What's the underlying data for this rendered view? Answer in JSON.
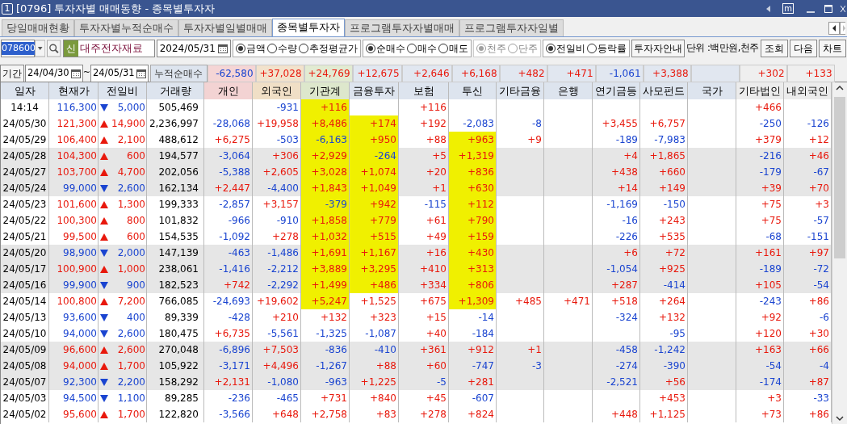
{
  "window": {
    "number": "1",
    "title": "[0796] 투자자별 매매동향 - 종목별투자자",
    "m_label": "m"
  },
  "tabs": [
    {
      "label": "당일매매현황",
      "selected": false
    },
    {
      "label": "투자자별누적순매수",
      "selected": false
    },
    {
      "label": "투자자별일별매매",
      "selected": false
    },
    {
      "label": "종목별투자자",
      "selected": true
    },
    {
      "label": "프로그램투자자별매매",
      "selected": false
    },
    {
      "label": "프로그램투자자일별",
      "selected": false
    }
  ],
  "toolbar": {
    "code": "078600",
    "badge": "신",
    "stock_name": "대주전자재료",
    "date": "2024/05/31",
    "radio_groups": [
      {
        "disabled": false,
        "options": [
          {
            "label": "금액",
            "selected": true
          },
          {
            "label": "수량",
            "selected": false
          },
          {
            "label": "추정평균가",
            "selected": false
          }
        ]
      },
      {
        "disabled": false,
        "options": [
          {
            "label": "순매수",
            "selected": true
          },
          {
            "label": "매수",
            "selected": false
          },
          {
            "label": "매도",
            "selected": false
          }
        ]
      },
      {
        "disabled": true,
        "options": [
          {
            "label": "천주",
            "selected": true
          },
          {
            "label": "단주",
            "selected": false
          }
        ]
      },
      {
        "disabled": false,
        "options": [
          {
            "label": "전일비",
            "selected": true
          },
          {
            "label": "등락률",
            "selected": false
          }
        ]
      }
    ],
    "guide_button": "투자자안내",
    "unit": "단위 :백만원,천주",
    "buttons": [
      "조회",
      "다음",
      "차트"
    ]
  },
  "period": {
    "label": "기간",
    "from": "24/04/30",
    "sep": "~",
    "to": "24/05/31",
    "summary_label": "누적순매수",
    "summary": {
      "individual": "-62,580",
      "foreign": "+37,028",
      "institution": "+24,769",
      "financial": "+12,675",
      "insurance": "+2,646",
      "trust": "+6,168",
      "other_finance": "+482",
      "bank": "+471",
      "pension": "-1,061",
      "private_fund": "+3,388",
      "other_corp": "+302",
      "domestic_foreign": "+133"
    }
  },
  "columns": [
    "일자",
    "현재가",
    "전일비",
    "거래량",
    "개인",
    "외국인",
    "기관계",
    "금융투자",
    "보험",
    "투신",
    "기타금융",
    "은행",
    "연기금등",
    "사모펀드",
    "국가",
    "기타법인",
    "내외국인"
  ],
  "rows": [
    {
      "date": "14:14",
      "price": "116,300",
      "change": "5,000",
      "volume": "505,469",
      "rising": false,
      "shaded": false,
      "highlighted": {
        "institution": true,
        "financial": false,
        "trust": false
      },
      "investors": {
        "foreign": "-931",
        "institution": "+116",
        "insurance": "+116",
        "other_corp": "+466"
      }
    },
    {
      "date": "24/05/30",
      "price": "121,300",
      "change": "14,900",
      "volume": "2,236,997",
      "rising": true,
      "shaded": false,
      "highlighted": {
        "institution": true,
        "financial": true,
        "trust": false
      },
      "investors": {
        "individual": "-28,068",
        "foreign": "+19,958",
        "institution": "+8,486",
        "financial": "+174",
        "insurance": "+192",
        "trust": "-2,083",
        "other_finance": "-8",
        "pension": "+3,455",
        "private_fund": "+6,757",
        "other_corp": "-250",
        "domestic_foreign": "-126"
      }
    },
    {
      "date": "24/05/29",
      "price": "106,400",
      "change": "2,100",
      "volume": "488,612",
      "rising": true,
      "shaded": false,
      "highlighted": {
        "institution": true,
        "financial": true,
        "trust": true
      },
      "investors": {
        "individual": "+6,275",
        "foreign": "-503",
        "institution": "-6,163",
        "financial": "+950",
        "insurance": "+88",
        "trust": "+963",
        "other_finance": "+9",
        "pension": "-189",
        "private_fund": "-7,983",
        "other_corp": "+379",
        "domestic_foreign": "+12"
      }
    },
    {
      "date": "24/05/28",
      "price": "104,300",
      "change": "600",
      "volume": "194,577",
      "rising": true,
      "shaded": true,
      "highlighted": {
        "institution": true,
        "financial": true,
        "trust": true
      },
      "investors": {
        "individual": "-3,064",
        "foreign": "+306",
        "institution": "+2,929",
        "financial": "-264",
        "insurance": "+5",
        "trust": "+1,319",
        "pension": "+4",
        "private_fund": "+1,865",
        "other_corp": "-216",
        "domestic_foreign": "+46"
      }
    },
    {
      "date": "24/05/27",
      "price": "103,700",
      "change": "4,700",
      "volume": "202,056",
      "rising": true,
      "shaded": true,
      "highlighted": {
        "institution": true,
        "financial": true,
        "trust": true
      },
      "investors": {
        "individual": "-5,388",
        "foreign": "+2,605",
        "institution": "+3,028",
        "financial": "+1,074",
        "insurance": "+20",
        "trust": "+836",
        "pension": "+438",
        "private_fund": "+660",
        "other_corp": "-179",
        "domestic_foreign": "-67"
      }
    },
    {
      "date": "24/05/24",
      "price": "99,000",
      "change": "2,600",
      "volume": "162,134",
      "rising": false,
      "shaded": true,
      "highlighted": {
        "institution": true,
        "financial": true,
        "trust": true
      },
      "investors": {
        "individual": "+2,447",
        "foreign": "-4,400",
        "institution": "+1,843",
        "financial": "+1,049",
        "insurance": "+1",
        "trust": "+630",
        "pension": "+14",
        "private_fund": "+149",
        "other_corp": "+39",
        "domestic_foreign": "+70"
      }
    },
    {
      "date": "24/05/23",
      "price": "101,600",
      "change": "1,300",
      "volume": "199,333",
      "rising": true,
      "shaded": false,
      "highlighted": {
        "institution": true,
        "financial": true,
        "trust": true
      },
      "investors": {
        "individual": "-2,857",
        "foreign": "+3,157",
        "institution": "-379",
        "financial": "+942",
        "insurance": "-115",
        "trust": "+112",
        "pension": "-1,169",
        "private_fund": "-150",
        "other_corp": "+75",
        "domestic_foreign": "+3"
      }
    },
    {
      "date": "24/05/22",
      "price": "100,300",
      "change": "800",
      "volume": "101,832",
      "rising": true,
      "shaded": false,
      "highlighted": {
        "institution": true,
        "financial": true,
        "trust": true
      },
      "investors": {
        "individual": "-966",
        "foreign": "-910",
        "institution": "+1,858",
        "financial": "+779",
        "insurance": "+61",
        "trust": "+790",
        "pension": "-16",
        "private_fund": "+243",
        "other_corp": "+75",
        "domestic_foreign": "-57"
      }
    },
    {
      "date": "24/05/21",
      "price": "99,500",
      "change": "600",
      "volume": "154,535",
      "rising": true,
      "shaded": false,
      "highlighted": {
        "institution": true,
        "financial": true,
        "trust": true
      },
      "investors": {
        "individual": "-1,092",
        "foreign": "+278",
        "institution": "+1,032",
        "financial": "+515",
        "insurance": "+49",
        "trust": "+159",
        "pension": "-226",
        "private_fund": "+535",
        "other_corp": "-68",
        "domestic_foreign": "-151"
      }
    },
    {
      "date": "24/05/20",
      "price": "98,900",
      "change": "2,000",
      "volume": "147,139",
      "rising": false,
      "shaded": true,
      "highlighted": {
        "institution": true,
        "financial": true,
        "trust": true
      },
      "investors": {
        "individual": "-463",
        "foreign": "-1,486",
        "institution": "+1,691",
        "financial": "+1,167",
        "insurance": "+16",
        "trust": "+430",
        "pension": "+6",
        "private_fund": "+72",
        "other_corp": "+161",
        "domestic_foreign": "+97"
      }
    },
    {
      "date": "24/05/17",
      "price": "100,900",
      "change": "1,000",
      "volume": "238,061",
      "rising": true,
      "shaded": true,
      "highlighted": {
        "institution": true,
        "financial": true,
        "trust": true
      },
      "investors": {
        "individual": "-1,416",
        "foreign": "-2,212",
        "institution": "+3,889",
        "financial": "+3,295",
        "insurance": "+410",
        "trust": "+313",
        "pension": "-1,054",
        "private_fund": "+925",
        "other_corp": "-189",
        "domestic_foreign": "-72"
      }
    },
    {
      "date": "24/05/16",
      "price": "99,900",
      "change": "900",
      "volume": "182,523",
      "rising": false,
      "shaded": true,
      "highlighted": {
        "institution": true,
        "financial": true,
        "trust": true
      },
      "investors": {
        "individual": "+742",
        "foreign": "-2,292",
        "institution": "+1,499",
        "financial": "+486",
        "insurance": "+334",
        "trust": "+806",
        "pension": "+287",
        "private_fund": "-414",
        "other_corp": "+105",
        "domestic_foreign": "-54"
      }
    },
    {
      "date": "24/05/14",
      "price": "100,800",
      "change": "7,200",
      "volume": "766,085",
      "rising": true,
      "shaded": false,
      "highlighted": {
        "institution": true,
        "financial": false,
        "trust": true
      },
      "investors": {
        "individual": "-24,693",
        "foreign": "+19,602",
        "institution": "+5,247",
        "financial": "+1,525",
        "insurance": "+675",
        "trust": "+1,309",
        "other_finance": "+485",
        "bank": "+471",
        "pension": "+518",
        "private_fund": "+264",
        "other_corp": "-243",
        "domestic_foreign": "+86"
      }
    },
    {
      "date": "24/05/13",
      "price": "93,600",
      "change": "400",
      "volume": "89,339",
      "rising": false,
      "shaded": false,
      "investors": {
        "individual": "-428",
        "foreign": "+210",
        "institution": "+132",
        "financial": "+323",
        "insurance": "+15",
        "trust": "-14",
        "pension": "-324",
        "private_fund": "+132",
        "other_corp": "+92",
        "domestic_foreign": "-6"
      }
    },
    {
      "date": "24/05/10",
      "price": "94,000",
      "change": "2,600",
      "volume": "180,475",
      "rising": false,
      "shaded": false,
      "investors": {
        "individual": "+6,735",
        "foreign": "-5,561",
        "institution": "-1,325",
        "financial": "-1,087",
        "insurance": "+40",
        "trust": "-184",
        "private_fund": "-95",
        "other_corp": "+120",
        "domestic_foreign": "+30"
      }
    },
    {
      "date": "24/05/09",
      "price": "96,600",
      "change": "2,600",
      "volume": "270,048",
      "rising": true,
      "shaded": true,
      "investors": {
        "individual": "-6,896",
        "foreign": "+7,503",
        "institution": "-836",
        "financial": "-410",
        "insurance": "+361",
        "trust": "+912",
        "other_finance": "+1",
        "pension": "-458",
        "private_fund": "-1,242",
        "other_corp": "+163",
        "domestic_foreign": "+66"
      }
    },
    {
      "date": "24/05/08",
      "price": "94,000",
      "change": "1,700",
      "volume": "105,922",
      "rising": true,
      "shaded": true,
      "investors": {
        "individual": "-3,171",
        "foreign": "+4,496",
        "institution": "-1,267",
        "financial": "+88",
        "insurance": "+60",
        "trust": "-747",
        "other_finance": "-3",
        "pension": "-274",
        "private_fund": "-390",
        "other_corp": "-54",
        "domestic_foreign": "-4"
      }
    },
    {
      "date": "24/05/07",
      "price": "92,300",
      "change": "2,200",
      "volume": "158,292",
      "rising": false,
      "shaded": true,
      "investors": {
        "individual": "+2,131",
        "foreign": "-1,080",
        "institution": "-963",
        "financial": "+1,225",
        "insurance": "-5",
        "trust": "+281",
        "pension": "-2,521",
        "private_fund": "+56",
        "other_corp": "-174",
        "domestic_foreign": "+87"
      }
    },
    {
      "date": "24/05/03",
      "price": "94,500",
      "change": "1,100",
      "volume": "89,285",
      "rising": false,
      "shaded": false,
      "investors": {
        "individual": "-236",
        "foreign": "-465",
        "institution": "+731",
        "financial": "+840",
        "insurance": "+45",
        "trust": "-607",
        "private_fund": "+453",
        "other_corp": "+3",
        "domestic_foreign": "-33"
      }
    },
    {
      "date": "24/05/02",
      "price": "95,600",
      "change": "1,700",
      "volume": "122,820",
      "rising": true,
      "shaded": false,
      "investors": {
        "individual": "-3,566",
        "foreign": "+648",
        "institution": "+2,758",
        "financial": "+83",
        "insurance": "+278",
        "trust": "+824",
        "pension": "+448",
        "private_fund": "+1,125",
        "other_corp": "+73",
        "domestic_foreign": "+86"
      }
    }
  ]
}
